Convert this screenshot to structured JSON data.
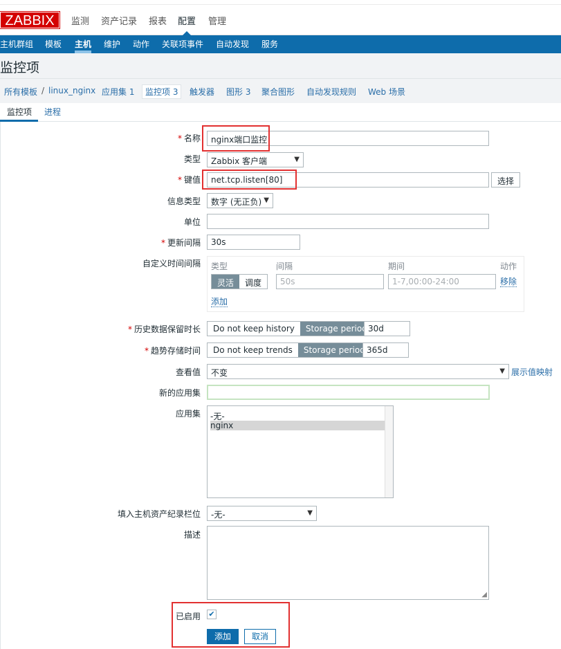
{
  "logo": "ZABBIX",
  "main_menu": [
    "监测",
    "资产记录",
    "报表",
    "配置",
    "管理"
  ],
  "sub_menu": [
    "主机群组",
    "模板",
    "主机",
    "维护",
    "动作",
    "关联项事件",
    "自动发现",
    "服务"
  ],
  "page_title": "监控项",
  "breadcrumb": {
    "all_templates": "所有模板",
    "sep": "/",
    "host": "linux_nginx",
    "applications": "应用集",
    "applications_count": "1",
    "items": "监控项",
    "items_count": "3",
    "triggers": "触发器",
    "graphs": "图形",
    "graphs_count": "3",
    "screens": "聚合图形",
    "discovery": "自动发现规则",
    "web": "Web 场景"
  },
  "tabs": [
    "监控项",
    "进程"
  ],
  "form": {
    "name_label": "名称",
    "name_value": "nginx端口监控",
    "type_label": "类型",
    "type_value": "Zabbix 客户端",
    "key_label": "键值",
    "key_value": "net.tcp.listen[80]",
    "select_button": "选择",
    "info_type_label": "信息类型",
    "info_type_value": "数字 (无正负)",
    "units_label": "单位",
    "units_value": "",
    "interval_label": "更新间隔",
    "interval_value": "30s",
    "custom_label": "自定义时间间隔",
    "custom": {
      "col_type": "类型",
      "col_interval": "间隔",
      "col_period": "期间",
      "col_action": "动作",
      "flexible": "灵活",
      "scheduling": "调度",
      "interval_placeholder": "50s",
      "period_placeholder": "1-7,00:00-24:00",
      "remove": "移除",
      "add": "添加"
    },
    "history_label": "历史数据保留时长",
    "history_opt1": "Do not keep history",
    "history_opt2": "Storage period",
    "history_value": "30d",
    "trends_label": "趋势存储时间",
    "trends_opt1": "Do not keep trends",
    "trends_opt2": "Storage period",
    "trends_value": "365d",
    "valuemap_label": "查看值",
    "valuemap_value": "不变",
    "valuemap_link": "展示值映射",
    "new_app_label": "新的应用集",
    "new_app_value": "",
    "apps_label": "应用集",
    "apps_options": [
      "-无-",
      "nginx"
    ],
    "inventory_label": "填入主机资产纪录栏位",
    "inventory_value": "-无-",
    "desc_label": "描述",
    "enabled_label": "已启用",
    "add_button": "添加",
    "cancel_button": "取消"
  },
  "colors": {
    "brand": "#d40000",
    "nav": "#0e6cab",
    "highlight_box": "#e23030",
    "focus_green": "#c5e4c1"
  }
}
